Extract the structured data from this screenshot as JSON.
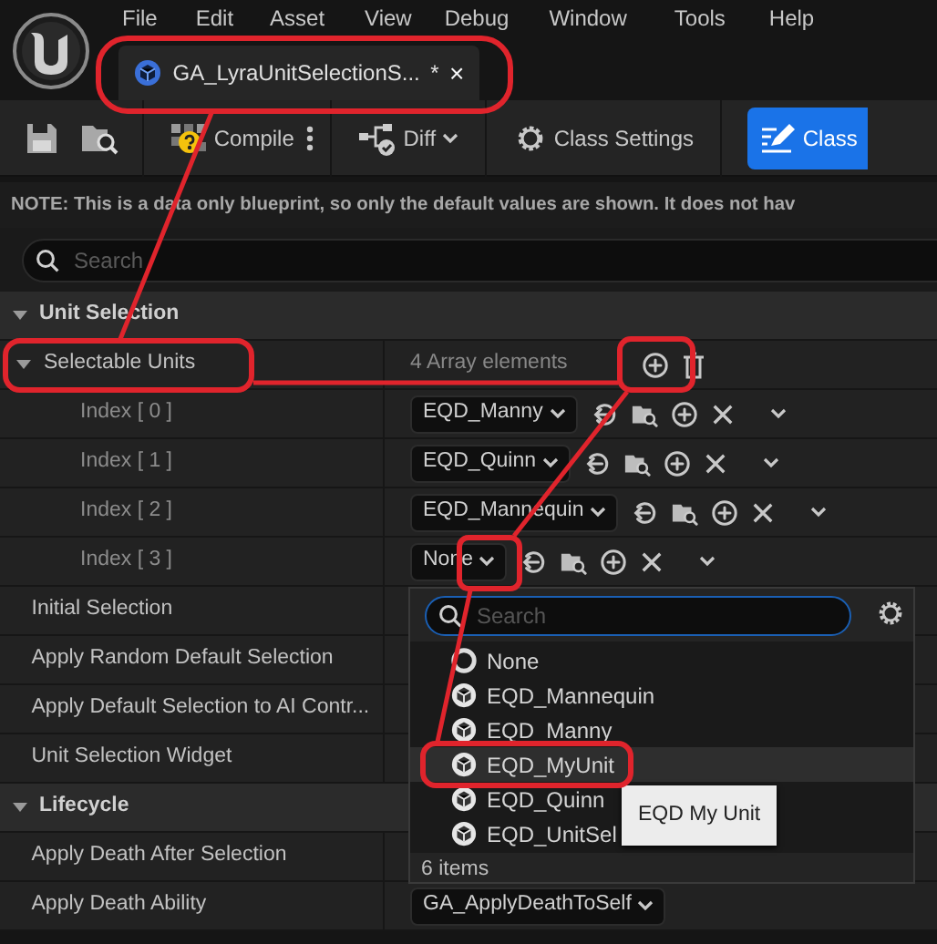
{
  "menu": [
    "File",
    "Edit",
    "Asset",
    "View",
    "Debug",
    "Window",
    "Tools",
    "Help"
  ],
  "document_tab": {
    "title": "GA_LyraUnitSelectionS...",
    "modified_mark": "*",
    "close": "×"
  },
  "toolbar": [
    {
      "kind": "compile",
      "label": "Compile",
      "selected": false
    },
    {
      "kind": "diff",
      "label": "Diff",
      "selected": false
    },
    {
      "kind": "settings",
      "label": "Class Settings",
      "selected": false
    },
    {
      "kind": "defaults",
      "label": "Class",
      "selected": true
    }
  ],
  "note": "NOTE: This is a data only blueprint, so only the default values are shown.  It does not hav",
  "search": {
    "placeholder": "Search"
  },
  "sections": [
    {
      "title": "Unit Selection",
      "expanded": true,
      "properties": [
        {
          "kind": "array",
          "label": "Selectable Units",
          "expanded": true,
          "summary": "4 Array elements",
          "elements": [
            {
              "label": "Index [ 0 ]",
              "value": "EQD_Manny"
            },
            {
              "label": "Index [ 1 ]",
              "value": "EQD_Quinn"
            },
            {
              "label": "Index [ 2 ]",
              "value": "EQD_Mannequin"
            },
            {
              "label": "Index [ 3 ]",
              "value": "None"
            }
          ]
        },
        {
          "kind": "plain",
          "label": "Initial Selection"
        },
        {
          "kind": "plain",
          "label": "Apply Random Default Selection"
        },
        {
          "kind": "plain",
          "label": "Apply Default Selection to AI Contr..."
        },
        {
          "kind": "plain",
          "label": "Unit Selection Widget"
        }
      ]
    },
    {
      "title": "Lifecycle",
      "expanded": true,
      "properties": [
        {
          "kind": "plain",
          "label": "Apply Death After Selection"
        },
        {
          "kind": "asset",
          "label": "Apply Death Ability",
          "value": "GA_ApplyDeathToSelf"
        }
      ]
    }
  ],
  "picker": {
    "search_placeholder": "Search",
    "items": [
      {
        "kind": "none",
        "label": "None",
        "selected": false
      },
      {
        "kind": "asset",
        "label": "EQD_Mannequin",
        "selected": false
      },
      {
        "kind": "asset",
        "label": "EQD_Manny",
        "selected": false
      },
      {
        "kind": "asset",
        "label": "EQD_MyUnit",
        "selected": true
      },
      {
        "kind": "asset",
        "label": "EQD_Quinn",
        "selected": false
      },
      {
        "kind": "asset",
        "label": "EQD_UnitSel",
        "selected": false
      }
    ],
    "count": "6 items",
    "tooltip": "EQD My Unit"
  }
}
